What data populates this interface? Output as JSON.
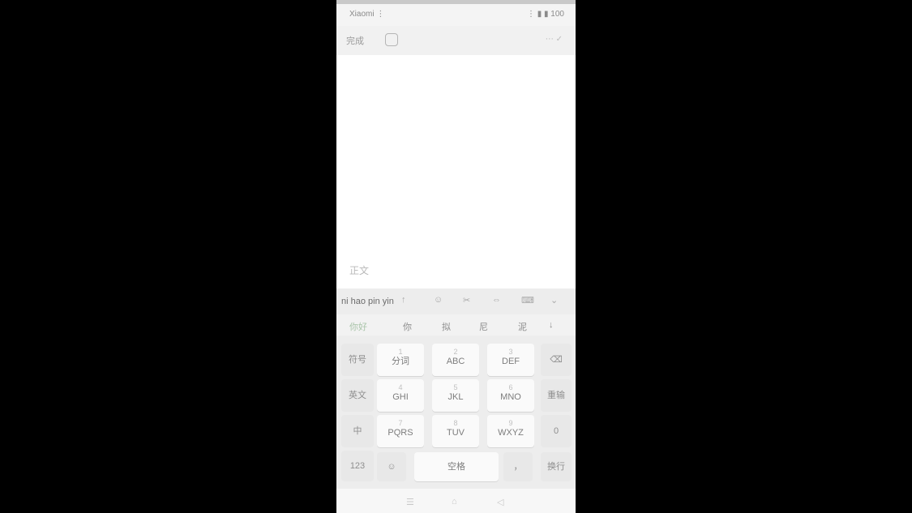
{
  "status_bar": {
    "carrier": "Xiaomi ⋮",
    "right": "⋮ ▮ ▮ 100"
  },
  "toolbar": {
    "left_label": "完成",
    "right_label": "⋯ ✓"
  },
  "editor": {
    "placeholder": "正文"
  },
  "keyboard": {
    "composition": "ni hao pin yin",
    "symbols": [
      "↑",
      "☺",
      "✂",
      "⇔",
      "⌨",
      "⌄"
    ],
    "candidates": [
      "你好",
      "你",
      "拟",
      "尼",
      "泥",
      "↓"
    ],
    "keys": {
      "r1": [
        {
          "sup": "1",
          "main": "分词"
        },
        {
          "sup": "2",
          "main": "ABC"
        },
        {
          "sup": "3",
          "main": "DEF"
        },
        {
          "sup": "",
          "main": "⌫"
        }
      ],
      "r2": [
        {
          "sup": "4",
          "main": "GHI"
        },
        {
          "sup": "5",
          "main": "JKL"
        },
        {
          "sup": "6",
          "main": "MNO"
        },
        {
          "sup": "",
          "main": "重输"
        }
      ],
      "r3": [
        {
          "sup": "7",
          "main": "PQRS"
        },
        {
          "sup": "8",
          "main": "TUV"
        },
        {
          "sup": "9",
          "main": "WXYZ"
        },
        {
          "sup": "",
          "main": "0"
        }
      ],
      "left_col": [
        "符号",
        "英文",
        "中",
        "123"
      ],
      "bottom": {
        "emoji": "☺",
        "lang": "中",
        "space": "空格",
        "comma": "，",
        "enter": "换行"
      }
    }
  },
  "nav": {
    "menu": "☰",
    "home": "⌂",
    "back": "◁"
  }
}
